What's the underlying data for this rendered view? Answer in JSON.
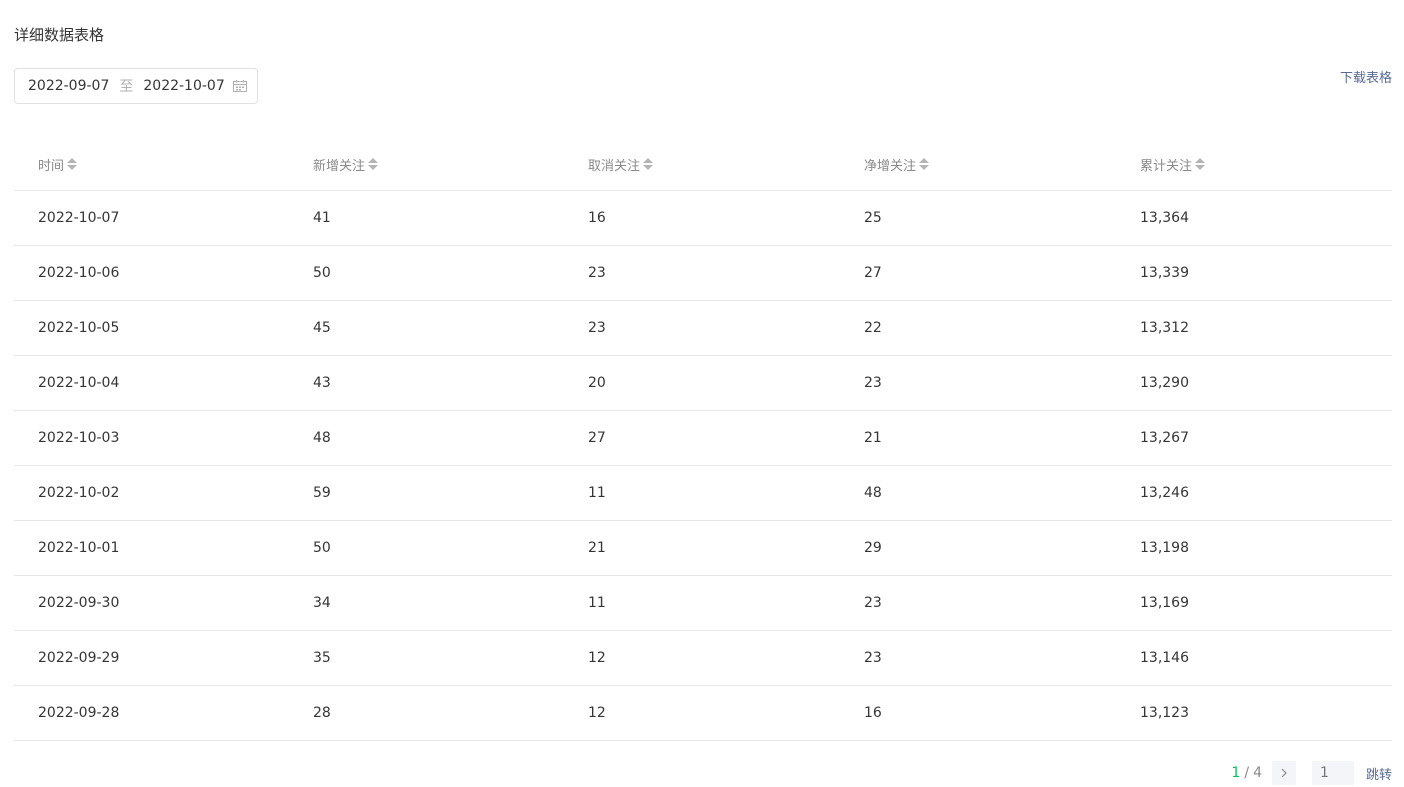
{
  "section_title": "详细数据表格",
  "date_range": {
    "start": "2022-09-07",
    "separator": "至",
    "end": "2022-10-07",
    "icon": "calendar-icon"
  },
  "download_label": "下载表格",
  "table": {
    "headers": [
      "时间",
      "新增关注",
      "取消关注",
      "净增关注",
      "累计关注"
    ],
    "rows": [
      [
        "2022-10-07",
        "41",
        "16",
        "25",
        "13,364"
      ],
      [
        "2022-10-06",
        "50",
        "23",
        "27",
        "13,339"
      ],
      [
        "2022-10-05",
        "45",
        "23",
        "22",
        "13,312"
      ],
      [
        "2022-10-04",
        "43",
        "20",
        "23",
        "13,290"
      ],
      [
        "2022-10-03",
        "48",
        "27",
        "21",
        "13,267"
      ],
      [
        "2022-10-02",
        "59",
        "11",
        "48",
        "13,246"
      ],
      [
        "2022-10-01",
        "50",
        "21",
        "29",
        "13,198"
      ],
      [
        "2022-09-30",
        "34",
        "11",
        "23",
        "13,169"
      ],
      [
        "2022-09-29",
        "35",
        "12",
        "23",
        "13,146"
      ],
      [
        "2022-09-28",
        "28",
        "12",
        "16",
        "13,123"
      ]
    ]
  },
  "pagination": {
    "current": "1",
    "separator": "/",
    "total": "4",
    "page_input_placeholder": "1",
    "jump_label": "跳转"
  },
  "colors": {
    "accent_green": "#07c160",
    "link_blue": "#576b95"
  }
}
